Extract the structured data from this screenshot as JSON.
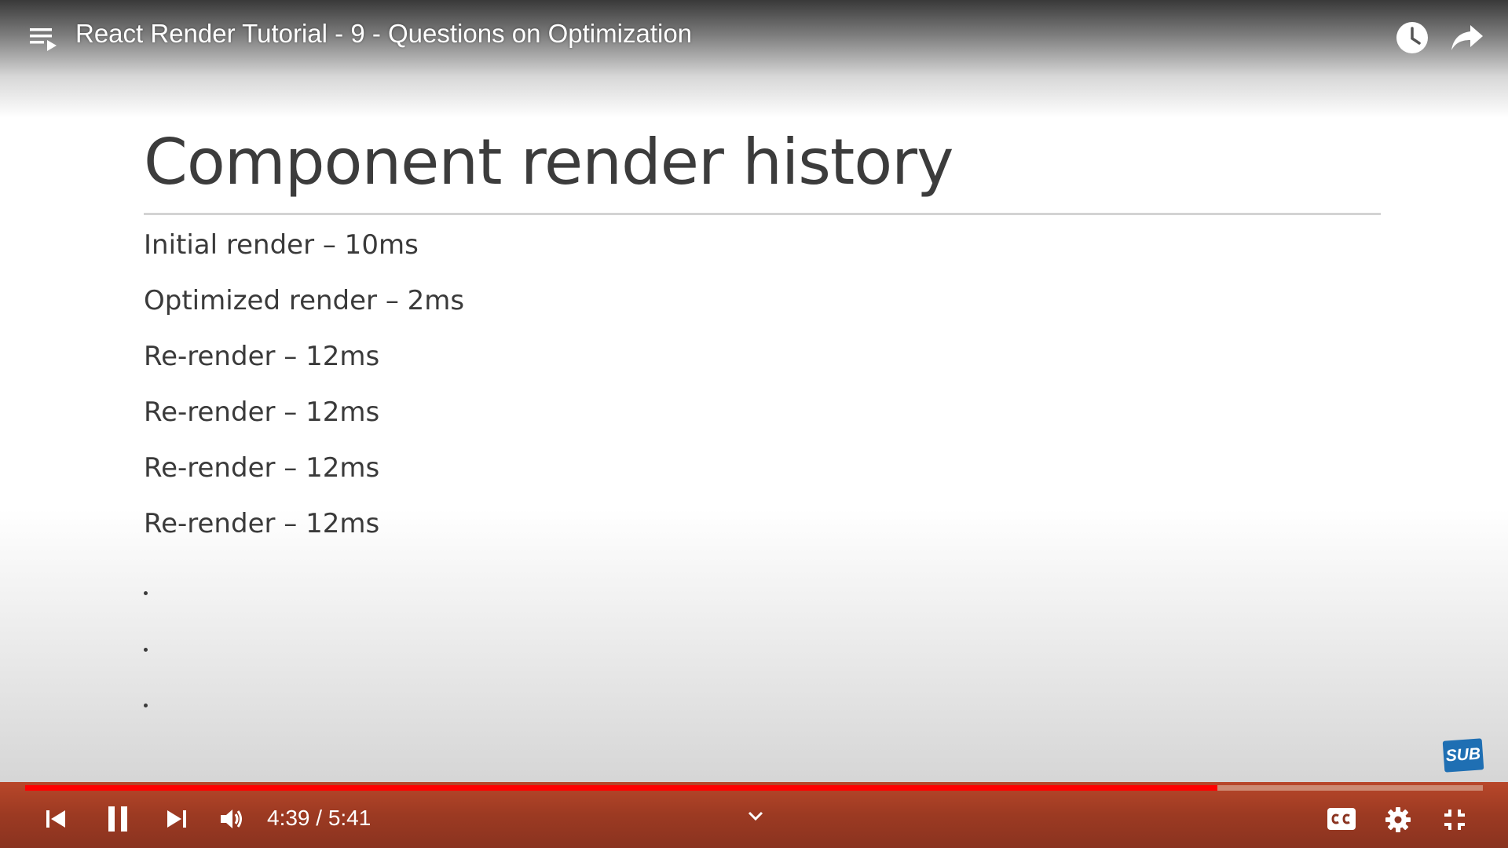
{
  "player": {
    "title": "React Render Tutorial - 9 - Questions on Optimization",
    "time_display": "4:39 / 5:41",
    "progress_fraction": 0.818,
    "sub_badge": "SUB"
  },
  "slide": {
    "title": "Component render history",
    "lines": [
      "Initial render – 10ms",
      "Optimized render – 2ms",
      "Re-render – 12ms",
      "Re-render – 12ms",
      "Re-render – 12ms",
      "Re-render – 12ms"
    ]
  },
  "colors": {
    "progress_played": "#ff0000",
    "sub_badge": "#1f6fb3"
  },
  "icons": [
    "playlist-icon",
    "watch-later-icon",
    "share-icon",
    "previous-icon",
    "pause-icon",
    "next-icon",
    "volume-icon",
    "chevron-down-icon",
    "closed-captions-icon",
    "gear-icon",
    "exit-fullscreen-icon"
  ]
}
